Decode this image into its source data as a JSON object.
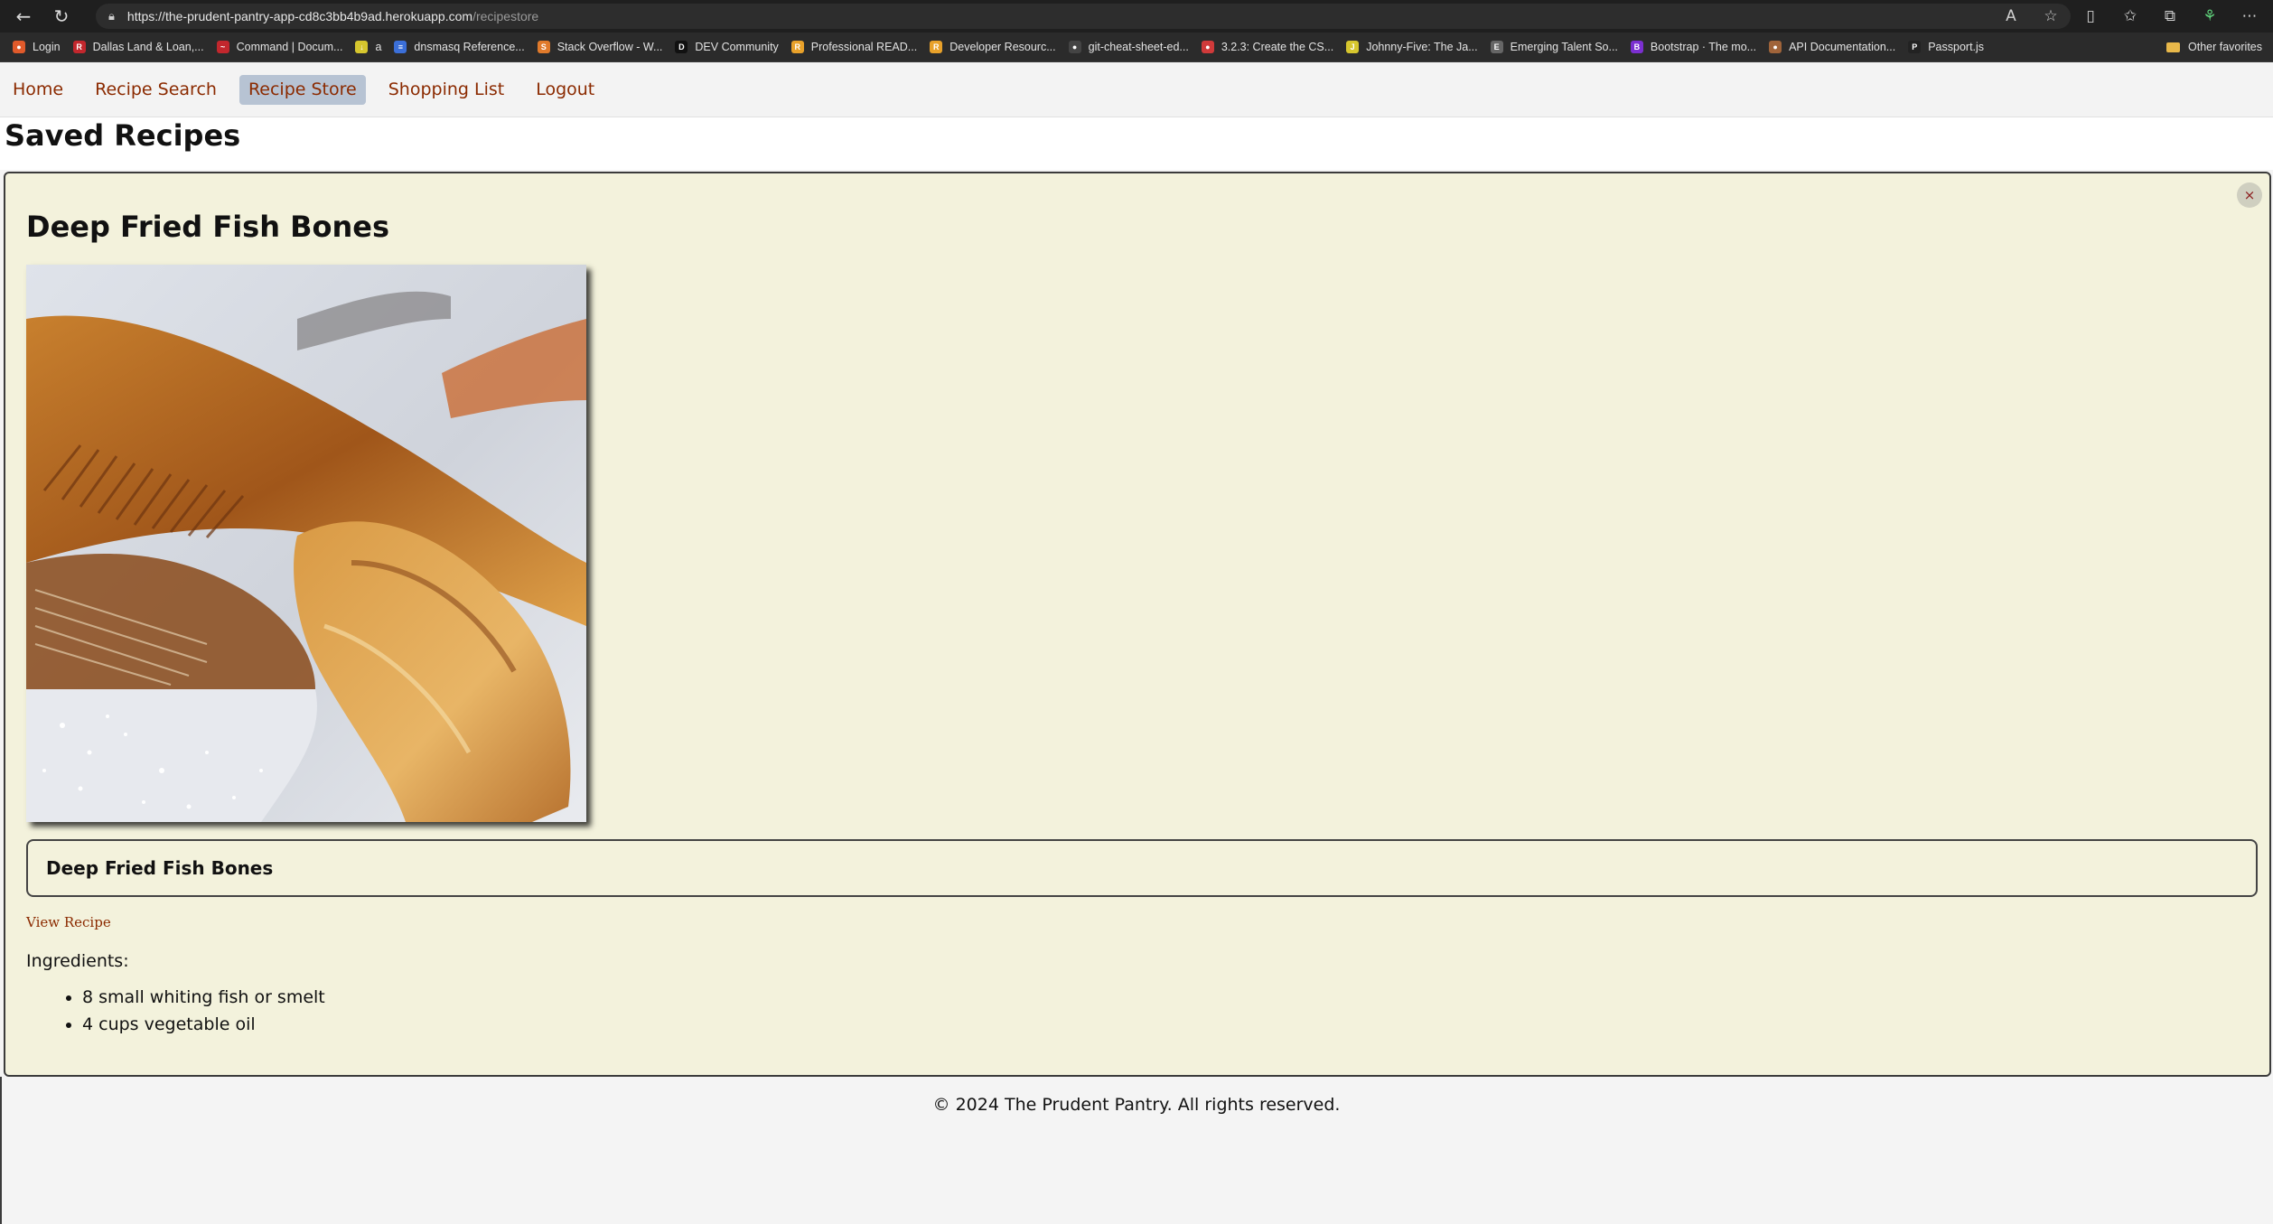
{
  "browser": {
    "url_host": "https://the-prudent-pantry-app-cd8c3bb4b9ad.herokuapp.com",
    "url_path": "/recipestore",
    "bookmarks": [
      {
        "label": "Login",
        "color": "#e05a2b",
        "glyph": "●"
      },
      {
        "label": "Dallas Land & Loan,...",
        "color": "#c2272d",
        "glyph": "R"
      },
      {
        "label": "Command | Docum...",
        "color": "#c2272d",
        "glyph": "~"
      },
      {
        "label": "a",
        "color": "#d6c62e",
        "glyph": "↓"
      },
      {
        "label": "dnsmasq Reference...",
        "color": "#3b6fd8",
        "glyph": "≡"
      },
      {
        "label": "Stack Overflow - W...",
        "color": "#e07a2b",
        "glyph": "S"
      },
      {
        "label": "DEV Community",
        "color": "#111111",
        "glyph": "D"
      },
      {
        "label": "Professional READ...",
        "color": "#e8a12a",
        "glyph": "R"
      },
      {
        "label": "Developer Resourc...",
        "color": "#e8a12a",
        "glyph": "R"
      },
      {
        "label": "git-cheat-sheet-ed...",
        "color": "#444444",
        "glyph": "●"
      },
      {
        "label": "3.2.3: Create the CS...",
        "color": "#d03a3a",
        "glyph": "●"
      },
      {
        "label": "Johnny-Five: The Ja...",
        "color": "#d6c62e",
        "glyph": "J"
      },
      {
        "label": "Emerging Talent So...",
        "color": "#666666",
        "glyph": "E"
      },
      {
        "label": "Bootstrap · The mo...",
        "color": "#7b2fd0",
        "glyph": "B"
      },
      {
        "label": "API Documentation...",
        "color": "#a0643a",
        "glyph": "●"
      },
      {
        "label": "Passport.js",
        "color": "#222222",
        "glyph": "P"
      }
    ],
    "other_favorites": "Other favorites"
  },
  "nav": {
    "home": "Home",
    "recipe_search": "Recipe Search",
    "recipe_store": "Recipe Store",
    "shopping_list": "Shopping List",
    "logout": "Logout"
  },
  "page": {
    "title": "Saved Recipes"
  },
  "recipe": {
    "title": "Deep Fried Fish Bones",
    "box_title": "Deep Fried Fish Bones",
    "close_label": "×",
    "view_link": "View Recipe",
    "ingredients_label": "Ingredients:",
    "ingredients": [
      "8 small whiting fish or smelt",
      "4 cups vegetable oil"
    ]
  },
  "footer": {
    "text": "© 2024 The Prudent Pantry. All rights reserved."
  }
}
